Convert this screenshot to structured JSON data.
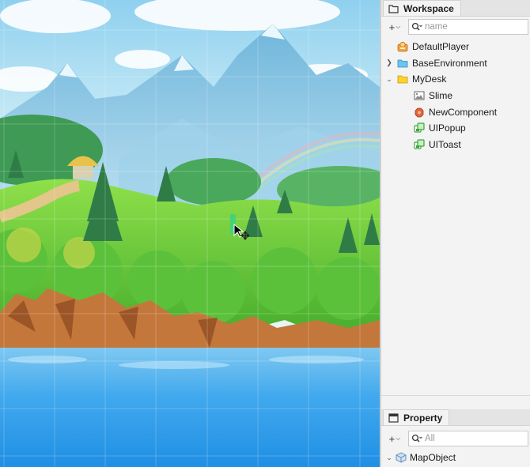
{
  "workspace": {
    "tab_label": "Workspace",
    "search_placeholder": "name",
    "add_button": "+",
    "items": [
      {
        "label": "DefaultPlayer",
        "icon": "player-icon",
        "depth": 0
      },
      {
        "label": "BaseEnvironment",
        "icon": "folder-blue-icon",
        "depth": 0,
        "expander": "collapsed"
      },
      {
        "label": "MyDesk",
        "icon": "folder-yellow-icon",
        "depth": 0,
        "expander": "expanded"
      },
      {
        "label": "Slime",
        "icon": "sprite-icon",
        "depth": 1
      },
      {
        "label": "NewComponent",
        "icon": "component-icon",
        "depth": 1
      },
      {
        "label": "UIPopup",
        "icon": "ui-group-icon",
        "depth": 1
      },
      {
        "label": "UIToast",
        "icon": "ui-group-icon",
        "depth": 1
      }
    ]
  },
  "property": {
    "tab_label": "Property",
    "search_placeholder": "All",
    "add_button": "+",
    "selected_object": "MapObject"
  },
  "colors": {
    "panel_bg": "#f3f3f3",
    "sky": "#bfe3f3",
    "water": "#2f9de8"
  }
}
